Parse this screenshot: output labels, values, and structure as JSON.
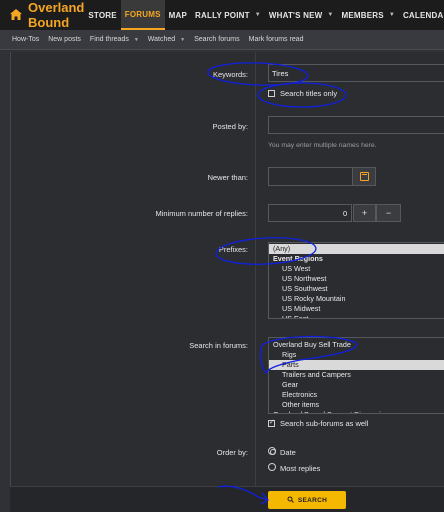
{
  "nav": {
    "brand": "Overland Bound",
    "items": [
      {
        "label": "STORE",
        "active": false,
        "caret": false
      },
      {
        "label": "FORUMS",
        "active": true,
        "caret": false
      },
      {
        "label": "MAP",
        "active": false,
        "caret": false
      },
      {
        "label": "RALLY POINT",
        "active": false,
        "caret": true
      },
      {
        "label": "WHAT'S NEW",
        "active": false,
        "caret": true
      },
      {
        "label": "MEMBERS",
        "active": false,
        "caret": true
      },
      {
        "label": "CALENDA",
        "active": false,
        "caret": false
      }
    ]
  },
  "subnav": {
    "items": [
      {
        "label": "How-Tos",
        "caret": false
      },
      {
        "label": "New posts",
        "caret": false
      },
      {
        "label": "Find threads",
        "caret": true
      },
      {
        "label": "Watched",
        "caret": true
      },
      {
        "label": "Search forums",
        "caret": false
      },
      {
        "label": "Mark forums read",
        "caret": false
      }
    ]
  },
  "form": {
    "keywords_label": "Keywords:",
    "keywords_value": "Tires",
    "titles_only_label": "Search titles only",
    "posted_by_label": "Posted by:",
    "posted_by_hint": "You may enter multiple names here.",
    "newer_than_label": "Newer than:",
    "min_replies_label": "Minimum number of replies:",
    "min_replies_value": "0",
    "plus": "+",
    "minus": "−",
    "prefixes_label": "Prefixes:",
    "prefixes": [
      {
        "text": "(Any)",
        "selected": true,
        "group": false,
        "indent": 0
      },
      {
        "text": "Event Regions",
        "selected": false,
        "group": true,
        "indent": 0
      },
      {
        "text": "US West",
        "selected": false,
        "group": false,
        "indent": 1
      },
      {
        "text": "US Northwest",
        "selected": false,
        "group": false,
        "indent": 1
      },
      {
        "text": "US Southwest",
        "selected": false,
        "group": false,
        "indent": 1
      },
      {
        "text": "US Rocky Mountain",
        "selected": false,
        "group": false,
        "indent": 1
      },
      {
        "text": "US Midwest",
        "selected": false,
        "group": false,
        "indent": 1
      },
      {
        "text": "US East",
        "selected": false,
        "group": false,
        "indent": 1,
        "cut": true
      }
    ],
    "search_in_label": "Search in forums:",
    "forums": [
      {
        "text": "Overland Buy Sell Trade",
        "selected": false,
        "indent": 0
      },
      {
        "text": "Rigs",
        "selected": false,
        "indent": 1
      },
      {
        "text": "Parts",
        "selected": true,
        "indent": 1
      },
      {
        "text": "Trailers and Campers",
        "selected": false,
        "indent": 1
      },
      {
        "text": "Gear",
        "selected": false,
        "indent": 1
      },
      {
        "text": "Electronics",
        "selected": false,
        "indent": 1
      },
      {
        "text": "Other items",
        "selected": false,
        "indent": 1
      },
      {
        "text": "Overland Bound Support Discussion",
        "selected": false,
        "indent": 0,
        "cut": true
      }
    ],
    "subforums_label": "Search sub-forums as well",
    "order_by_label": "Order by:",
    "order_date": "Date",
    "order_replies": "Most replies",
    "search_button": "SEARCH"
  }
}
